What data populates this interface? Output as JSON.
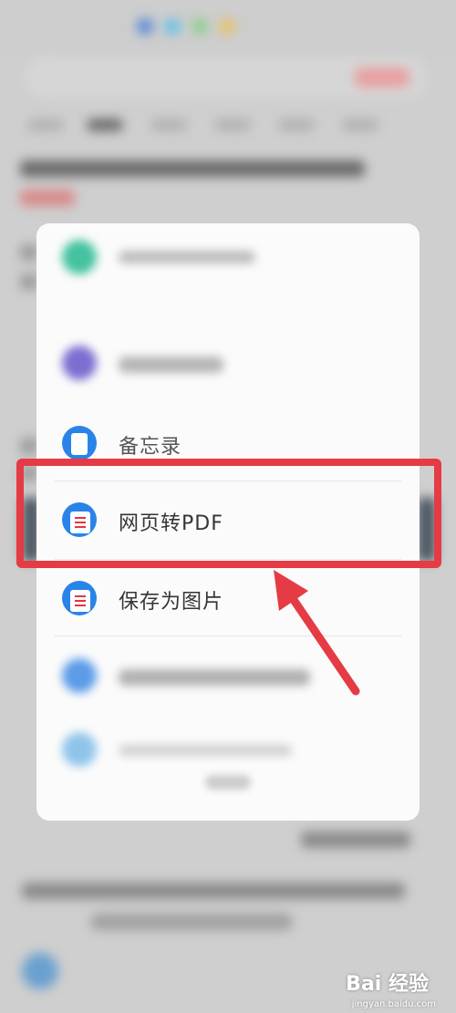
{
  "share_sheet": {
    "items": [
      {
        "label": "备忘录",
        "icon": "memo-icon"
      },
      {
        "label": "网页转PDF",
        "icon": "pdf-doc-icon"
      },
      {
        "label": "保存为图片",
        "icon": "pdf-doc-icon"
      }
    ]
  },
  "watermark": {
    "brand": "Bai 经验",
    "site": "jingyan.baidu.com"
  },
  "colors": {
    "highlight": "#e53b45",
    "icon_blue": "#2a84e8",
    "doc_lines": "#e8323e"
  }
}
